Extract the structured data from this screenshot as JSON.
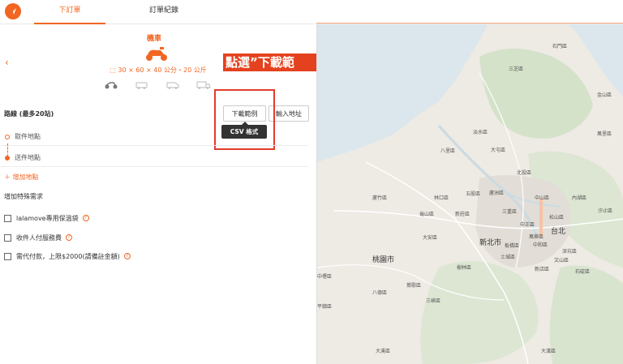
{
  "header": {
    "tabs": [
      {
        "label": "下訂單",
        "active": true
      },
      {
        "label": "訂單紀錄",
        "active": false
      }
    ],
    "accent_color": "#f16622"
  },
  "vehicle": {
    "title": "機車",
    "dimensions": "30 × 60 × 40 公分・20 公斤"
  },
  "route": {
    "label": "路線 (最多20站)",
    "download_button": "下載範例",
    "input_button": "輸入地址",
    "tooltip": "CSV 格式",
    "stops": [
      "取件地點",
      "送件地點"
    ],
    "add_stop": "增加地點"
  },
  "callout": "點選”下載範例“",
  "special": {
    "title": "增加特殊需求",
    "options": [
      "lalamove專用保溫袋",
      "收件人付服務費",
      "需代付款，上限$2000(請備註金額)"
    ]
  },
  "map": {
    "places": [
      {
        "name": "石門區"
      },
      {
        "name": "三芝區"
      },
      {
        "name": "金山區"
      },
      {
        "name": "萬里區"
      },
      {
        "name": "淡水區"
      },
      {
        "name": "八里區"
      },
      {
        "name": "北投區"
      },
      {
        "name": "蘆竹區"
      },
      {
        "name": "林口區"
      },
      {
        "name": "五股區"
      },
      {
        "name": "蘆洲區"
      },
      {
        "name": "中山區"
      },
      {
        "name": "內湖區"
      },
      {
        "name": "汐止區"
      },
      {
        "name": "龜山區"
      },
      {
        "name": "新莊區"
      },
      {
        "name": "三重區"
      },
      {
        "name": "中正區"
      },
      {
        "name": "松山區"
      },
      {
        "name": "萬華區"
      },
      {
        "name": "新北市"
      },
      {
        "name": "台北"
      },
      {
        "name": "桃園市"
      },
      {
        "name": "樹林區"
      },
      {
        "name": "土城區"
      },
      {
        "name": "板橋區"
      },
      {
        "name": "中和區"
      },
      {
        "name": "文山區"
      },
      {
        "name": "深坑區"
      },
      {
        "name": "八德區"
      },
      {
        "name": "大溪區"
      },
      {
        "name": "三峽區"
      },
      {
        "name": "新店區"
      },
      {
        "name": "中壢區"
      },
      {
        "name": "平鎮區"
      },
      {
        "name": "大安區"
      },
      {
        "name": "鶯歌區"
      },
      {
        "name": "石碇區"
      },
      {
        "name": "大漢區"
      },
      {
        "name": "大屯區"
      }
    ]
  }
}
